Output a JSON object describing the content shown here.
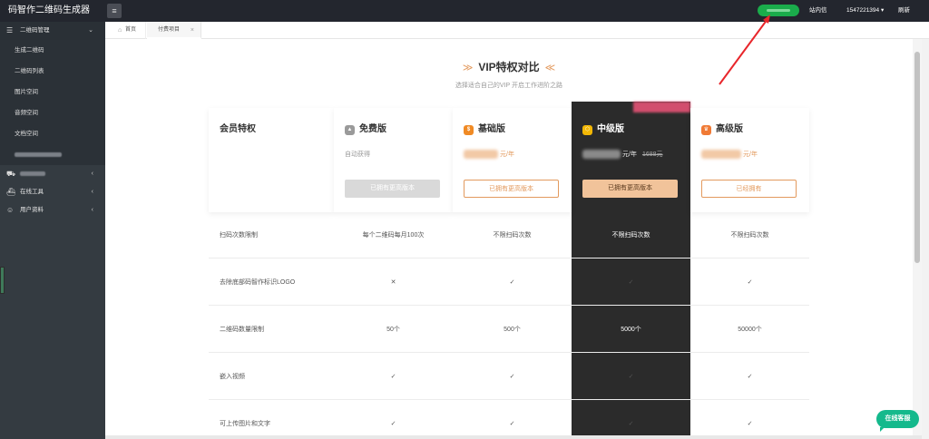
{
  "app": {
    "title": "码智作二维码生成器"
  },
  "topbar": {
    "menu_icon": "hamburger-icon",
    "message_label": "站内信",
    "account": "1547221394",
    "account_caret": "▾",
    "refresh_label": "刷新"
  },
  "sidebar": {
    "groups": [
      {
        "label": "二维码管理",
        "icon": "list-icon",
        "chevron": "⌄"
      },
      {
        "label": "",
        "icon": "cart-icon",
        "chevron": "‹"
      },
      {
        "label": "在线工具",
        "icon": "truck-icon",
        "chevron": "‹"
      },
      {
        "label": "用户资料",
        "icon": "user-icon",
        "chevron": "‹"
      }
    ],
    "items": [
      "生成二维码",
      "二维码列表",
      "图片空间",
      "音频空间",
      "文档空间"
    ]
  },
  "tabs": [
    {
      "label": "首页",
      "icon": "home-icon"
    },
    {
      "label": "付费项目",
      "close": "×"
    }
  ],
  "hero": {
    "title": "VIP特权对比",
    "deco_left": "≫",
    "deco_right": "≪",
    "subtitle": "选择适合自己的VIP 开启工作进阶之路"
  },
  "compare": {
    "header_label": "会员特权",
    "plans": [
      {
        "name": "免费版",
        "badge_color": "#9a9a9a",
        "price": "自动获得",
        "button": "已拥有更高版本"
      },
      {
        "name": "基础版",
        "badge_color": "#f08a24",
        "unit": "元/年",
        "button": "已拥有更高版本"
      },
      {
        "name": "中级版",
        "badge_color": "#f2b705",
        "unit": "元/年",
        "original_price": "1688元",
        "button": "已拥有更高版本"
      },
      {
        "name": "高级版",
        "badge_color": "#f07a35",
        "unit": "元/年",
        "button": "已经拥有"
      }
    ],
    "rows": [
      {
        "label": "扫码次数限制",
        "values": [
          "每个二维码每月100次",
          "不限扫码次数",
          "不限扫码次数",
          "不限扫码次数"
        ]
      },
      {
        "label": "去除底部码智作标识LOGO",
        "values": [
          "✕",
          "✓",
          "✓",
          "✓"
        ]
      },
      {
        "label": "二维码数量限制",
        "values": [
          "50个",
          "500个",
          "5000个",
          "50000个"
        ]
      },
      {
        "label": "嵌入视频",
        "values": [
          "✓",
          "✓",
          "✓",
          "✓"
        ]
      },
      {
        "label": "可上传图片和文字",
        "values": [
          "✓",
          "✓",
          "✓",
          "✓"
        ]
      }
    ]
  },
  "service": {
    "label": "在线客服"
  },
  "colors": {
    "accent": "#e39a5e",
    "check": "#1bb38a",
    "cross": "#f07f2c",
    "annotation": "#e8262b"
  }
}
